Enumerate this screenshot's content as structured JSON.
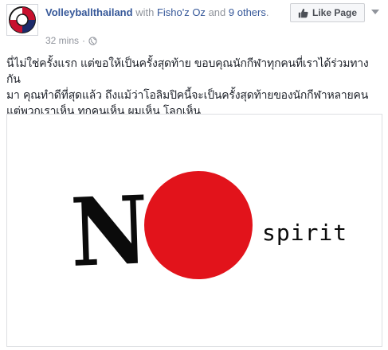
{
  "header": {
    "page_name": "Volleyballthailand",
    "with_text": "with",
    "tagged_name": "Fisho'z Oz",
    "and_text": "and",
    "others_text": "9 others",
    "period": ".",
    "time": "32 mins",
    "separator": "·",
    "like_page_label": "Like Page"
  },
  "post": {
    "lines": [
      "นี่ไม่ใช่ครั้งแรก แต่ขอให้เป็นครั้งสุดท้าย ขอบคุณนักกีฬาทุกคนที่เราได้ร่วมทางกัน",
      "มา คุณทำดีที่สุดแล้ว ถึงแม้ว่าโอลิมปิคนี้จะเป็นครั้งสุดท้ายของนักกีฬาหลายคน",
      "แต่พวกเราเห็น ทุกคนเห็น ผมเห็น โลกเห็น"
    ]
  },
  "image": {
    "letter": "N",
    "word": "spirit",
    "circle_color": "#e2131b"
  },
  "colors": {
    "link": "#365899",
    "meta": "#90949c",
    "text": "#1d2129"
  }
}
